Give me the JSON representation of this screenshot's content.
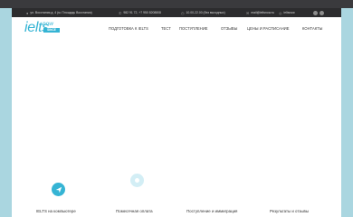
{
  "topbar": {
    "address": "ул. Восстания д. 4 (м. Площадь Восстания)",
    "phones": "982 91 72, +7 950 8208808",
    "hours": "10.00-22.00 (без выходных)",
    "email": "mail@ieltsnow.ru",
    "handle": "ieltsnow"
  },
  "logo": {
    "main": "ielts",
    "now": "now",
    "badge": "SINCE"
  },
  "nav": {
    "item1": "ПОДГОТОВКА К IELTS",
    "item2": "ТЕСТ",
    "item3": "ПОСТУПЛЕНИЕ",
    "item4": "ОТЗЫВЫ",
    "item5": "ЦЕНЫ И РАСПИСАНИЕ",
    "item6": "КОНТАКТЫ"
  },
  "features": {
    "f1": "IELTS на компьютере",
    "f2": "Помесячная оплата",
    "f3": "Поступление и иммиграция",
    "f4": "Результаты и отзывы"
  },
  "colors": {
    "accent": "#35b4d4",
    "topbar": "#2c2c2e",
    "frame": "#aad6e0"
  }
}
